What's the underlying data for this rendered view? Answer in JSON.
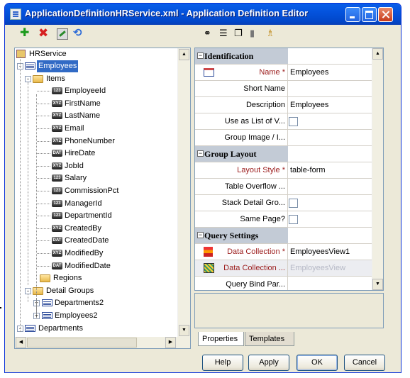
{
  "window": {
    "title": "ApplicationDefinitionHRService.xml - Application Definition Editor"
  },
  "tree": {
    "root": "HRService",
    "nodes": [
      {
        "label": "Employees",
        "selected": true,
        "icon": "view-object-icon"
      },
      {
        "label": "Items",
        "icon": "folder-icon"
      },
      {
        "label": "EmployeeId",
        "icon": "attribute-number-icon"
      },
      {
        "label": "FirstName",
        "icon": "attribute-string-icon"
      },
      {
        "label": "LastName",
        "icon": "attribute-string-icon"
      },
      {
        "label": "Email",
        "icon": "attribute-string-icon"
      },
      {
        "label": "PhoneNumber",
        "icon": "attribute-string-icon"
      },
      {
        "label": "HireDate",
        "icon": "attribute-date-icon"
      },
      {
        "label": "JobId",
        "icon": "attribute-string-icon"
      },
      {
        "label": "Salary",
        "icon": "attribute-number-icon"
      },
      {
        "label": "CommissionPct",
        "icon": "attribute-number-icon"
      },
      {
        "label": "ManagerId",
        "icon": "attribute-number-icon"
      },
      {
        "label": "DepartmentId",
        "icon": "attribute-number-icon"
      },
      {
        "label": "CreatedBy",
        "icon": "attribute-string-icon"
      },
      {
        "label": "CreatedDate",
        "icon": "attribute-date-icon"
      },
      {
        "label": "ModifiedBy",
        "icon": "attribute-string-icon"
      },
      {
        "label": "ModifiedDate",
        "icon": "attribute-date-icon"
      },
      {
        "label": "Regions",
        "icon": "folder-icon"
      },
      {
        "label": "Detail Groups",
        "icon": "folder-icon"
      },
      {
        "label": "Departments2",
        "icon": "view-object-icon"
      },
      {
        "label": "Employees2",
        "icon": "view-object-icon"
      },
      {
        "label": "Departments",
        "icon": "view-object-icon"
      }
    ]
  },
  "properties": {
    "sections": [
      {
        "title": "Identification",
        "rows": [
          {
            "name": "Name *",
            "value": "Employees",
            "required": true,
            "icon": "group-icon"
          },
          {
            "name": "Short Name",
            "value": ""
          },
          {
            "name": "Description",
            "value": "Employees"
          },
          {
            "name": "Use as List of V...",
            "checkbox": true
          },
          {
            "name": "Group Image / I...",
            "value": ""
          }
        ]
      },
      {
        "title": "Group Layout",
        "rows": [
          {
            "name": "Layout Style *",
            "value": "table-form",
            "required": true
          },
          {
            "name": "Table Overflow ...",
            "value": ""
          },
          {
            "name": "Stack Detail Gro...",
            "checkbox": true
          },
          {
            "name": "Same Page?",
            "checkbox": true
          }
        ]
      },
      {
        "title": "Query Settings",
        "rows": [
          {
            "name": "Data Collection *",
            "value": "EmployeesView1",
            "required": true,
            "icon": "data-collection-icon"
          },
          {
            "name": "Data Collection ...",
            "value": "EmployeesView",
            "required": true,
            "ghost": true,
            "icon": "data-collection-alt-icon"
          },
          {
            "name": "Query Bind Par...",
            "value": ""
          }
        ]
      }
    ]
  },
  "tabs": {
    "properties": "Properties",
    "templates": "Templates"
  },
  "buttons": {
    "help": "Help",
    "apply": "Apply",
    "ok": "OK",
    "cancel": "Cancel"
  },
  "colors": {
    "titlebar": "#0453dd",
    "selection": "#316ac5",
    "section_header": "#c3cbd6",
    "required_label": "#9b1b1b"
  }
}
